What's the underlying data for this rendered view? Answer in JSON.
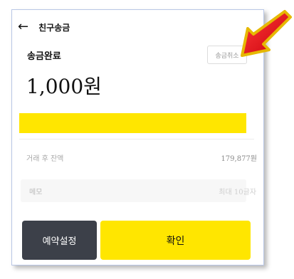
{
  "header": {
    "back_icon": "back-arrow-icon",
    "title": "친구송금"
  },
  "status": {
    "label": "송금완료",
    "cancel_label": "송금취소"
  },
  "amount": {
    "value": "1,000원"
  },
  "balance": {
    "label": "거래 후 잔액",
    "value": "179,877원"
  },
  "memo": {
    "label": "메모",
    "placeholder": "최대 10글자"
  },
  "actions": {
    "reserve_label": "예약설정",
    "confirm_label": "확인"
  },
  "colors": {
    "accent_yellow": "#ffe600",
    "dark_button": "#3c4049",
    "annotation_arrow": "#e8141d"
  }
}
